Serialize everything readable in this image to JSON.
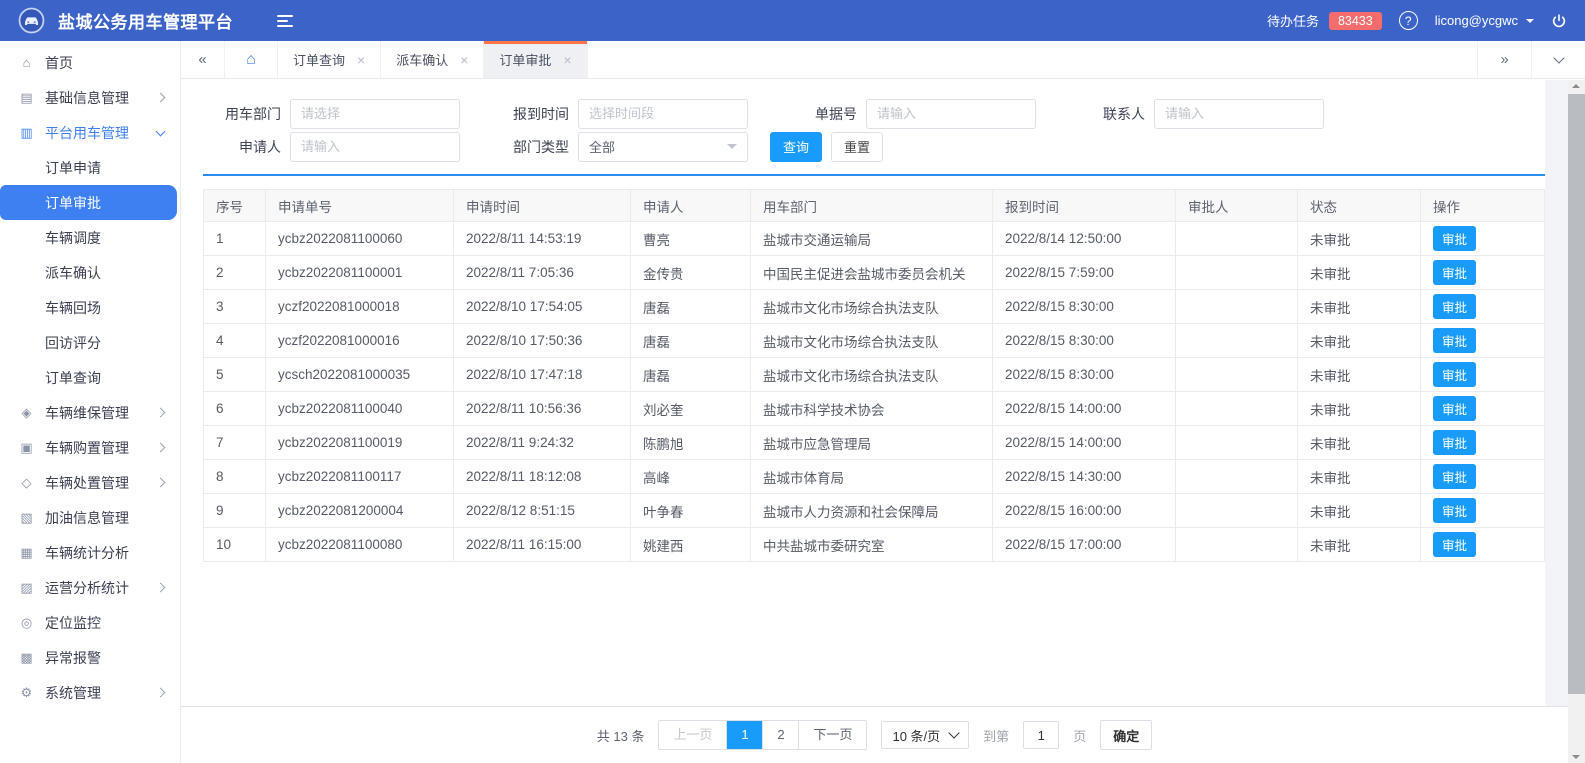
{
  "header": {
    "title": "盐城公务用车管理平台",
    "pending_label": "待办任务",
    "pending_count": "83433",
    "user": "licong@ycgwc"
  },
  "icons": {
    "home": "⌂",
    "base_info": "▤",
    "platform": "▥",
    "maintenance": "◈",
    "purchase": "▣",
    "disposal": "◇",
    "fuel": "▧",
    "stats": "▦",
    "operation": "▨",
    "location": "◎",
    "alarm": "▩",
    "system": "⚙",
    "close": "×",
    "collapse_left": "«",
    "collapse_right": "»",
    "help": "?",
    "tab_home": "⌂"
  },
  "sidebar": {
    "items": [
      {
        "label": "首页"
      },
      {
        "label": "基础信息管理"
      },
      {
        "label": "平台用车管理"
      },
      {
        "label": "车辆维保管理"
      },
      {
        "label": "车辆购置管理"
      },
      {
        "label": "车辆处置管理"
      },
      {
        "label": "加油信息管理"
      },
      {
        "label": "车辆统计分析"
      },
      {
        "label": "运营分析统计"
      },
      {
        "label": "定位监控"
      },
      {
        "label": "异常报警"
      },
      {
        "label": "系统管理"
      }
    ],
    "submenu": [
      {
        "label": "订单申请"
      },
      {
        "label": "订单审批",
        "active": true
      },
      {
        "label": "车辆调度"
      },
      {
        "label": "派车确认"
      },
      {
        "label": "车辆回场"
      },
      {
        "label": "回访评分"
      },
      {
        "label": "订单查询"
      }
    ]
  },
  "tabbar": {
    "tabs": [
      {
        "label": "订单查询"
      },
      {
        "label": "派车确认"
      },
      {
        "label": "订单审批",
        "active": true
      }
    ]
  },
  "filters": {
    "department_label": "用车部门",
    "department_placeholder": "请选择",
    "report_time_label": "报到时间",
    "report_time_placeholder": "选择时间段",
    "order_no_label": "单据号",
    "order_no_placeholder": "请输入",
    "contact_label": "联系人",
    "contact_placeholder": "请输入",
    "applicant_label": "申请人",
    "applicant_placeholder": "请输入",
    "dept_type_label": "部门类型",
    "dept_type_value": "全部",
    "search": "查询",
    "reset": "重置"
  },
  "table": {
    "columns": [
      "序号",
      "申请单号",
      "申请时间",
      "申请人",
      "用车部门",
      "报到时间",
      "审批人",
      "状态",
      "操作"
    ],
    "rows": [
      {
        "sn": "1",
        "order_no": "ycbz2022081100060",
        "apply_time": "2022/8/11 14:53:19",
        "applicant": "曹亮",
        "department": "盐城市交通运输局",
        "report_time": "2022/8/14 12:50:00",
        "approver": "",
        "status": "未审批",
        "action": "审批"
      },
      {
        "sn": "2",
        "order_no": "ycbz2022081100001",
        "apply_time": "2022/8/11 7:05:36",
        "applicant": "金传贵",
        "department": "中国民主促进会盐城市委员会机关",
        "report_time": "2022/8/15 7:59:00",
        "approver": "",
        "status": "未审批",
        "action": "审批"
      },
      {
        "sn": "3",
        "order_no": "yczf2022081000018",
        "apply_time": "2022/8/10 17:54:05",
        "applicant": "唐磊",
        "department": "盐城市文化市场综合执法支队",
        "report_time": "2022/8/15 8:30:00",
        "approver": "",
        "status": "未审批",
        "action": "审批"
      },
      {
        "sn": "4",
        "order_no": "yczf2022081000016",
        "apply_time": "2022/8/10 17:50:36",
        "applicant": "唐磊",
        "department": "盐城市文化市场综合执法支队",
        "report_time": "2022/8/15 8:30:00",
        "approver": "",
        "status": "未审批",
        "action": "审批"
      },
      {
        "sn": "5",
        "order_no": "ycsch2022081000035",
        "apply_time": "2022/8/10 17:47:18",
        "applicant": "唐磊",
        "department": "盐城市文化市场综合执法支队",
        "report_time": "2022/8/15 8:30:00",
        "approver": "",
        "status": "未审批",
        "action": "审批"
      },
      {
        "sn": "6",
        "order_no": "ycbz2022081100040",
        "apply_time": "2022/8/11 10:56:36",
        "applicant": "刘必奎",
        "department": "盐城市科学技术协会",
        "report_time": "2022/8/15 14:00:00",
        "approver": "",
        "status": "未审批",
        "action": "审批"
      },
      {
        "sn": "7",
        "order_no": "ycbz2022081100019",
        "apply_time": "2022/8/11 9:24:32",
        "applicant": "陈鹏旭",
        "department": "盐城市应急管理局",
        "report_time": "2022/8/15 14:00:00",
        "approver": "",
        "status": "未审批",
        "action": "审批"
      },
      {
        "sn": "8",
        "order_no": "ycbz2022081100117",
        "apply_time": "2022/8/11 18:12:08",
        "applicant": "高峰",
        "department": "盐城市体育局",
        "report_time": "2022/8/15 14:30:00",
        "approver": "",
        "status": "未审批",
        "action": "审批"
      },
      {
        "sn": "9",
        "order_no": "ycbz2022081200004",
        "apply_time": "2022/8/12 8:51:15",
        "applicant": "叶争春",
        "department": "盐城市人力资源和社会保障局",
        "report_time": "2022/8/15 16:00:00",
        "approver": "",
        "status": "未审批",
        "action": "审批"
      },
      {
        "sn": "10",
        "order_no": "ycbz2022081100080",
        "apply_time": "2022/8/11 16:15:00",
        "applicant": "姚建西",
        "department": "中共盐城市委研究室",
        "report_time": "2022/8/15 17:00:00",
        "approver": "",
        "status": "未审批",
        "action": "审批"
      }
    ]
  },
  "pagination": {
    "total": "共 13 条",
    "prev": "上一页",
    "page1": "1",
    "page2": "2",
    "next": "下一页",
    "page_size": "10 条/页",
    "goto_prefix": "到第",
    "goto_value": "1",
    "goto_suffix": "页",
    "confirm": "确定"
  },
  "colors": {
    "header_blue": "#3c64c8",
    "sidebar_active_blue": "#3e80f2",
    "accent_blue": "#199cf9",
    "badge_red": "#f56c6c",
    "active_tab_orange": "#ff7746",
    "divider_blue": "#2d8cf0"
  }
}
